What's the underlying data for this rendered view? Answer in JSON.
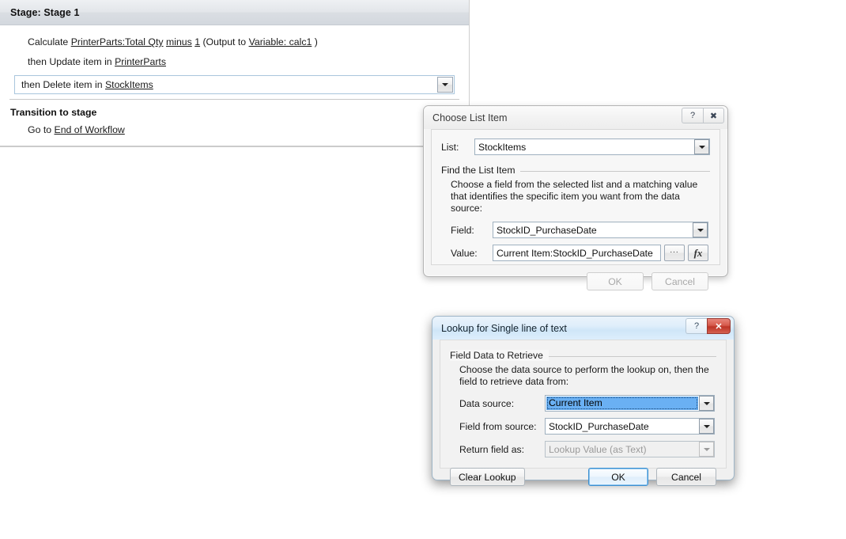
{
  "workflow": {
    "stage_title": "Stage: Stage 1",
    "lines": [
      {
        "id": "calculate",
        "segments": [
          {
            "text": "Calculate ",
            "link": false
          },
          {
            "text": "PrinterParts:Total Qty",
            "link": true
          },
          {
            "text": " ",
            "link": false
          },
          {
            "text": "minus",
            "link": true
          },
          {
            "text": " ",
            "link": false
          },
          {
            "text": "1",
            "link": true
          },
          {
            "text": " (Output to ",
            "link": false
          },
          {
            "text": "Variable: calc1",
            "link": true
          },
          {
            "text": " )",
            "link": false
          }
        ]
      },
      {
        "id": "update-item",
        "segments": [
          {
            "text": "then Update item in ",
            "link": false
          },
          {
            "text": "PrinterParts",
            "link": true
          }
        ]
      }
    ],
    "selected_line": {
      "prefix": "then Delete item in ",
      "link": "StockItems",
      "dropdown_icon": "chevron-down-icon"
    },
    "transition_header": "Transition to stage",
    "transition_line": {
      "prefix": "Go to ",
      "link": "End of Workflow"
    }
  },
  "choose_list_item_dialog": {
    "title": "Choose List Item",
    "help_icon": "question-mark-icon",
    "close_icon": "close-x-icon",
    "list_label": "List:",
    "list_value": "StockItems",
    "group_legend": "Find the List Item",
    "help_text": "Choose a field from the selected list and a matching value that identifies the specific item you want from the data source:",
    "field_label": "Field:",
    "field_value": "StockID_PurchaseDate",
    "value_label": "Value:",
    "value_value": "Current Item:StockID_PurchaseDate",
    "ellipsis_button": "...",
    "fx_button": "fx",
    "ok_label": "OK",
    "cancel_label": "Cancel"
  },
  "lookup_dialog": {
    "title": "Lookup for Single line of text",
    "help_icon": "question-mark-icon",
    "close_icon": "close-x-icon",
    "group_legend": "Field Data to Retrieve",
    "help_text": "Choose the data source to perform the lookup on, then the field to retrieve data from:",
    "data_source_label": "Data source:",
    "data_source_value": "Current Item",
    "field_from_source_label": "Field from source:",
    "field_from_source_value": "StockID_PurchaseDate",
    "return_field_label": "Return field as:",
    "return_field_value": "Lookup Value (as Text)",
    "clear_lookup_label": "Clear Lookup",
    "ok_label": "OK",
    "cancel_label": "Cancel"
  },
  "colors": {
    "selection_blue": "#6ab0f3",
    "close_red": "#bd3426",
    "default_button_border": "#3c8fd0",
    "stage_header_gray": "#dadee3"
  }
}
